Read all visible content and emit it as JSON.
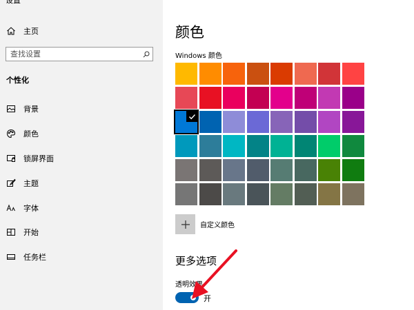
{
  "app": {
    "title": "设置"
  },
  "sidebar": {
    "home_label": "主页",
    "search_placeholder": "查找设置",
    "section_title": "个性化",
    "items": [
      {
        "label": "背景",
        "icon": "picture-icon"
      },
      {
        "label": "颜色",
        "icon": "palette-icon"
      },
      {
        "label": "锁屏界面",
        "icon": "lock-screen-icon"
      },
      {
        "label": "主题",
        "icon": "theme-brush-icon"
      },
      {
        "label": "字体",
        "icon": "font-icon"
      },
      {
        "label": "开始",
        "icon": "start-icon"
      },
      {
        "label": "任务栏",
        "icon": "taskbar-icon"
      }
    ]
  },
  "main": {
    "page_title": "颜色",
    "windows_colors_label": "Windows 颜色",
    "swatches": [
      [
        "#ffb900",
        "#ff8c00",
        "#f7630c",
        "#ca5010",
        "#da3b01",
        "#ef6950",
        "#d13438",
        "#ff4343"
      ],
      [
        "#e74856",
        "#e81123",
        "#ea005e",
        "#c30052",
        "#e3008c",
        "#bf0077",
        "#c239b3",
        "#9a0089"
      ],
      [
        "#0078d7",
        "#0063b1",
        "#8e8cd8",
        "#6b69d6",
        "#8764b8",
        "#744da9",
        "#b146c2",
        "#881798"
      ],
      [
        "#0099bc",
        "#2d7d9a",
        "#00b7c3",
        "#038387",
        "#00b294",
        "#018574",
        "#00cc6a",
        "#10893e"
      ],
      [
        "#7a7574",
        "#5d5a58",
        "#68768a",
        "#515c6b",
        "#567c73",
        "#486860",
        "#498205",
        "#107c10"
      ],
      [
        "#767676",
        "#4c4a48",
        "#69797e",
        "#4a5459",
        "#647c64",
        "#525e54",
        "#847545",
        "#7e735f"
      ]
    ],
    "selected_swatch": {
      "row": 2,
      "col": 0
    },
    "custom_color_label": "自定义颜色",
    "more_options_title": "更多选项",
    "transparency_label": "透明效果",
    "transparency_state": "开",
    "transparency_on": true
  },
  "colors": {
    "sidebar_bg": "#f2f2f2",
    "accent": "#0063b1",
    "annotation_arrow": "#e81123"
  }
}
